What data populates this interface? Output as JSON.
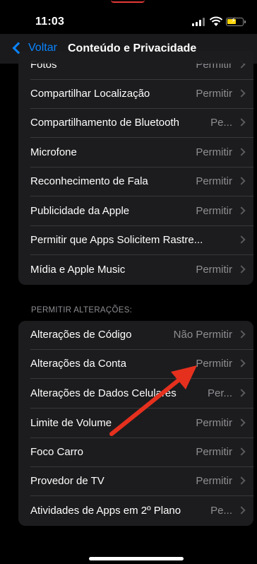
{
  "status_bar": {
    "time": "11:03"
  },
  "nav": {
    "back_label": "Voltar",
    "title": "Conteúdo e Privacidade"
  },
  "group1": {
    "rows": [
      {
        "label": "Fotos",
        "value": "Permitir"
      },
      {
        "label": "Compartilhar Localização",
        "value": "Permitir"
      },
      {
        "label": "Compartilhamento de Bluetooth",
        "value": "Pe..."
      },
      {
        "label": "Microfone",
        "value": "Permitir"
      },
      {
        "label": "Reconhecimento de Fala",
        "value": "Permitir"
      },
      {
        "label": "Publicidade da Apple",
        "value": "Permitir"
      },
      {
        "label": "Permitir que Apps Solicitem Rastre...",
        "value": ""
      },
      {
        "label": "Mídia e Apple Music",
        "value": "Permitir"
      }
    ]
  },
  "section2": {
    "header": "PERMITIR ALTERAÇÕES:",
    "rows": [
      {
        "label": "Alterações de Código",
        "value": "Não Permitir"
      },
      {
        "label": "Alterações da Conta",
        "value": "Permitir"
      },
      {
        "label": "Alterações de Dados Celulares",
        "value": "Per..."
      },
      {
        "label": "Limite de Volume",
        "value": "Permitir"
      },
      {
        "label": "Foco Carro",
        "value": "Permitir"
      },
      {
        "label": "Provedor de TV",
        "value": "Permitir"
      },
      {
        "label": "Atividades de Apps em 2º Plano",
        "value": "Pe..."
      }
    ]
  },
  "colors": {
    "accent": "#0a84ff",
    "annotation_arrow": "#e5301e",
    "battery": "#ffd60a"
  },
  "icons": [
    "signal-icon",
    "wifi-icon",
    "battery-icon",
    "back-chevron-icon",
    "chevron-right-icon"
  ]
}
